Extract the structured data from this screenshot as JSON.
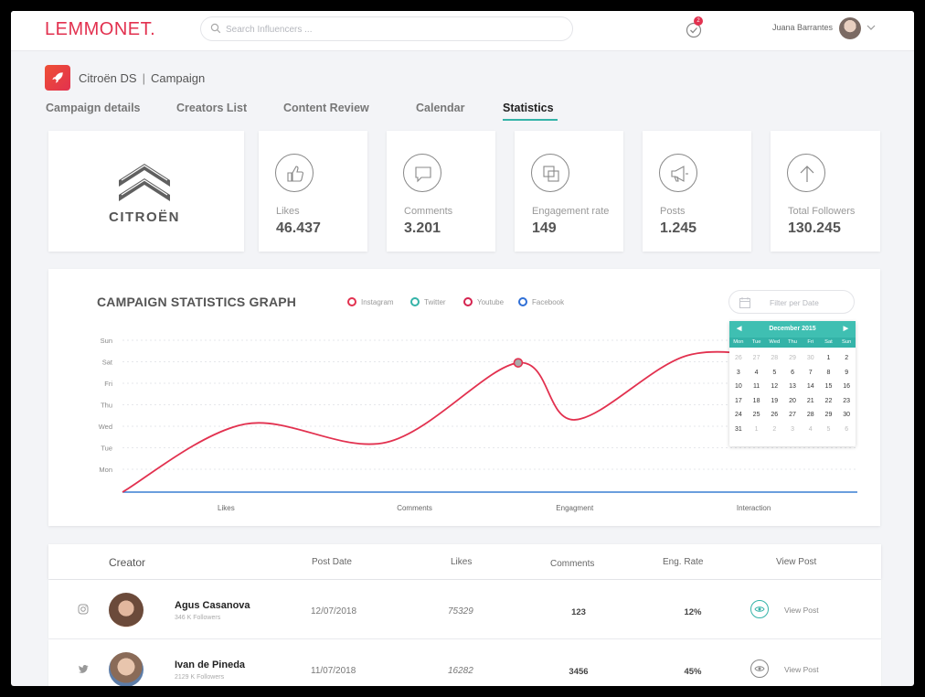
{
  "app": {
    "logo": "LEMMONET.",
    "search_placeholder": "Search Influencers ...",
    "notifications_count": "2",
    "user_name": "Juana Barrantes"
  },
  "breadcrumb": {
    "brand": "Citroën DS",
    "separator": "|",
    "section": "Campaign"
  },
  "tabs": [
    {
      "label": "Campaign details"
    },
    {
      "label": "Creators List"
    },
    {
      "label": "Content  Review"
    },
    {
      "label": "Calendar"
    },
    {
      "label": "Statistics",
      "active": true
    }
  ],
  "brand_card": {
    "name": "CITROËN"
  },
  "stats": [
    {
      "label": "Likes",
      "value": "46.437",
      "icon": "thumbs-up-icon"
    },
    {
      "label": "Comments",
      "value": "3.201",
      "icon": "chat-bubble-icon"
    },
    {
      "label": "Engagement rate",
      "value": "149",
      "icon": "layers-icon"
    },
    {
      "label": "Posts",
      "value": "1.245",
      "icon": "megaphone-icon"
    },
    {
      "label": "Total Followers",
      "value": "130.245",
      "icon": "arrow-up-icon"
    }
  ],
  "graph": {
    "title": "CAMPAIGN STATISTICS GRAPH",
    "legend": [
      {
        "name": "Instagram",
        "color": "#e2314f"
      },
      {
        "name": "Twitter",
        "color": "#34b3a8"
      },
      {
        "name": "Youtube",
        "color": "#d5234f"
      },
      {
        "name": "Facebook",
        "color": "#2f6fd6"
      }
    ],
    "filter_placeholder": "Filter per Date"
  },
  "chart_data": {
    "type": "line",
    "categories": [
      "Likes",
      "Comments",
      "Engagment",
      "Interaction"
    ],
    "y_tick_labels": [
      "Mon",
      "Tue",
      "Wed",
      "Thu",
      "Fri",
      "Sat",
      "Sun"
    ],
    "series": [
      {
        "name": "Instagram",
        "color": "#e2314f",
        "points": [
          [
            0,
            0
          ],
          [
            0.65,
            2.1
          ],
          [
            1.4,
            1.25
          ],
          [
            2.1,
            4.95
          ],
          [
            2.4,
            2.3
          ],
          [
            3.0,
            5.3
          ],
          [
            3.55,
            5.05
          ]
        ]
      },
      {
        "name": "Twitter",
        "color": "#34b3a8",
        "points": [
          [
            0,
            0
          ],
          [
            3.9,
            0
          ]
        ]
      },
      {
        "name": "Facebook",
        "color": "#2f6fd6",
        "points": [
          [
            0,
            0
          ],
          [
            3.9,
            0
          ]
        ]
      }
    ],
    "highlight": {
      "series": "Instagram",
      "x": 2.1,
      "y": 4.95
    },
    "grid": true
  },
  "calendar": {
    "month": "December 2015",
    "weekdays": [
      "Mon",
      "Tue",
      "Wed",
      "Thu",
      "Fri",
      "Sat",
      "Sun"
    ],
    "weeks": [
      [
        "26",
        "27",
        "28",
        "29",
        "30",
        "1",
        "2"
      ],
      [
        "3",
        "4",
        "5",
        "6",
        "7",
        "8",
        "9"
      ],
      [
        "10",
        "11",
        "12",
        "13",
        "14",
        "15",
        "16"
      ],
      [
        "17",
        "18",
        "19",
        "20",
        "21",
        "22",
        "23"
      ],
      [
        "24",
        "25",
        "26",
        "27",
        "28",
        "29",
        "30"
      ],
      [
        "31",
        "1",
        "2",
        "3",
        "4",
        "5",
        "6"
      ]
    ]
  },
  "table": {
    "headers": {
      "creator": "Creator",
      "post_date": "Post Date",
      "likes": "Likes",
      "comments": "Comments",
      "eng_rate": "Eng. Rate",
      "view_post": "View Post"
    },
    "rows": [
      {
        "network": "instagram-icon",
        "name": "Agus Casanova",
        "followers": "346 K Followers",
        "post_date": "12/07/2018",
        "likes": "75329",
        "comments": "123",
        "eng_rate": "12%",
        "view_label": "View Post",
        "eye_color": "#34b3a8"
      },
      {
        "network": "twitter-icon",
        "name": "Ivan de Pineda",
        "followers": "2129 K Followers",
        "post_date": "11/07/2018",
        "likes": "16282",
        "comments": "3456",
        "eng_rate": "45%",
        "view_label": "View Post",
        "eye_color": "#888888"
      }
    ]
  }
}
